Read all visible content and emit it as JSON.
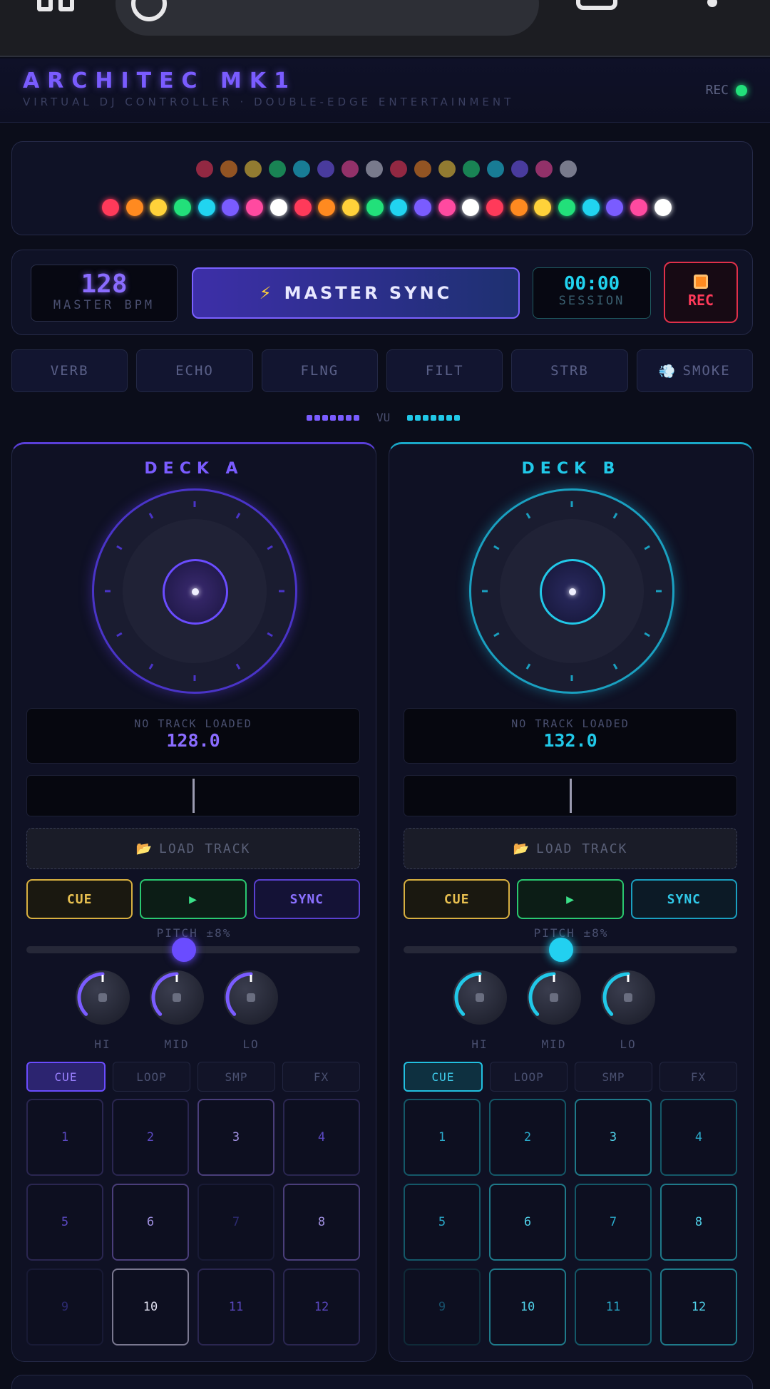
{
  "app": {
    "title": "ARCHITEC MK1",
    "subtitle": "VIRTUAL DJ CONTROLLER · DOUBLE-EDGE ENTERTAINMENT",
    "rec_status_label": "REC",
    "rec_status_color": "#22e07a"
  },
  "lights": {
    "top_row": [
      "#ff3a5a",
      "#ff8a20",
      "#ffd23a",
      "#22e07a",
      "#21d4f0",
      "#7a5cff",
      "#ff4aa0",
      "#cfd0e0",
      "#ff3a5a",
      "#ff8a20",
      "#ffd23a",
      "#22e07a",
      "#21d4f0",
      "#7a5cff",
      "#ff4aa0",
      "#cfd0e0"
    ],
    "bottom_row": [
      "#ff3a5a",
      "#ff8a20",
      "#ffd23a",
      "#22e07a",
      "#21d4f0",
      "#7a5cff",
      "#ff4aa0",
      "#ffffff",
      "#ff3a5a",
      "#ff8a20",
      "#ffd23a",
      "#22e07a",
      "#21d4f0",
      "#7a5cff",
      "#ff4aa0",
      "#ffffff",
      "#ff3a5a",
      "#ff8a20",
      "#ffd23a",
      "#22e07a",
      "#21d4f0",
      "#7a5cff",
      "#ff4aa0",
      "#ffffff"
    ]
  },
  "master": {
    "bpm": "128",
    "bpm_label": "MASTER BPM",
    "sync_icon": "⚡",
    "sync_label": "MASTER SYNC",
    "session_time": "00:00",
    "session_label": "SESSION",
    "rec_label": "REC"
  },
  "fx": [
    {
      "label": "VERB",
      "icon": ""
    },
    {
      "label": "ECHO",
      "icon": ""
    },
    {
      "label": "FLNG",
      "icon": ""
    },
    {
      "label": "FILT",
      "icon": ""
    },
    {
      "label": "STRB",
      "icon": ""
    },
    {
      "label": "SMOKE",
      "icon": "💨"
    }
  ],
  "vu": {
    "label": "VU"
  },
  "decks": {
    "a": {
      "title": "DECK A",
      "track_name": "NO TRACK LOADED",
      "bpm": "128.0",
      "load_icon": "📂",
      "load_label": "LOAD TRACK",
      "cue_label": "CUE",
      "play_label": "▶",
      "sync_label": "SYNC",
      "pitch_label": "PITCH ±8%",
      "pitch_value": 0.5,
      "eq": [
        {
          "label": "HI"
        },
        {
          "label": "MID"
        },
        {
          "label": "LO"
        }
      ],
      "pad_tabs": [
        "CUE",
        "LOOP",
        "SMP",
        "FX"
      ],
      "active_tab": "CUE",
      "pads": [
        "1",
        "2",
        "3",
        "4",
        "5",
        "6",
        "7",
        "8",
        "9",
        "10",
        "11",
        "12"
      ]
    },
    "b": {
      "title": "DECK B",
      "track_name": "NO TRACK LOADED",
      "bpm": "132.0",
      "load_icon": "📂",
      "load_label": "LOAD TRACK",
      "cue_label": "CUE",
      "play_label": "▶",
      "sync_label": "SYNC",
      "pitch_label": "PITCH ±8%",
      "pitch_value": 0.5,
      "eq": [
        {
          "label": "HI"
        },
        {
          "label": "MID"
        },
        {
          "label": "LO"
        }
      ],
      "pad_tabs": [
        "CUE",
        "LOOP",
        "SMP",
        "FX"
      ],
      "active_tab": "CUE",
      "pads": [
        "1",
        "2",
        "3",
        "4",
        "5",
        "6",
        "7",
        "8",
        "9",
        "10",
        "11",
        "12"
      ]
    }
  },
  "colors": {
    "deck_a_accent": "#7a5cff",
    "deck_b_accent": "#21c8e8",
    "cue": "#e8c050",
    "play": "#3ae088",
    "rec": "#ff3a5a"
  }
}
